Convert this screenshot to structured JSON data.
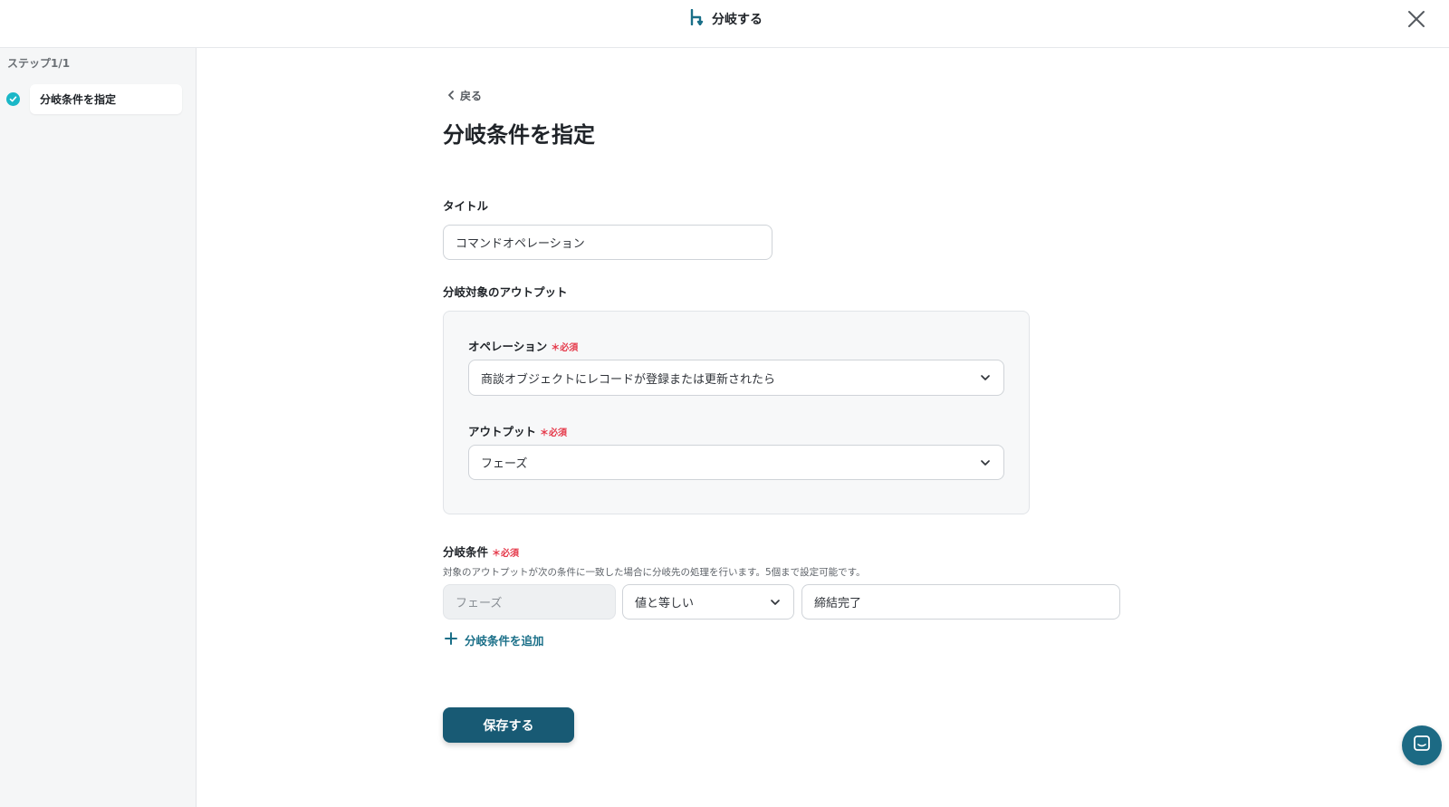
{
  "header": {
    "title": "分岐する",
    "brand_color": "#1a6f88"
  },
  "sidebar": {
    "step_label": "ステップ1/1",
    "items": [
      {
        "label": "分岐条件を指定",
        "status": "complete"
      }
    ]
  },
  "main": {
    "back_label": "戻る",
    "page_title": "分岐条件を指定",
    "title_field": {
      "label": "タイトル",
      "value": "コマンドオペレーション"
    },
    "output_section": {
      "label": "分岐対象のアウトプット",
      "operation": {
        "label": "オペレーション",
        "required": "必須",
        "value": "商談オブジェクトにレコードが登録または更新されたら"
      },
      "output": {
        "label": "アウトプット",
        "required": "必須",
        "value": "フェーズ"
      }
    },
    "condition_section": {
      "label": "分岐条件",
      "required": "必須",
      "help": "対象のアウトプットが次の条件に一致した場合に分岐先の処理を行います。5個まで設定可能です。",
      "conditions": [
        {
          "field": "フェーズ",
          "operator": "値と等しい",
          "value": "締結完了"
        }
      ],
      "add_label": "分岐条件を追加"
    },
    "save_label": "保存する"
  },
  "colors": {
    "primary": "#185a74",
    "required": "#e5394a",
    "check": "#1ab7c7"
  }
}
